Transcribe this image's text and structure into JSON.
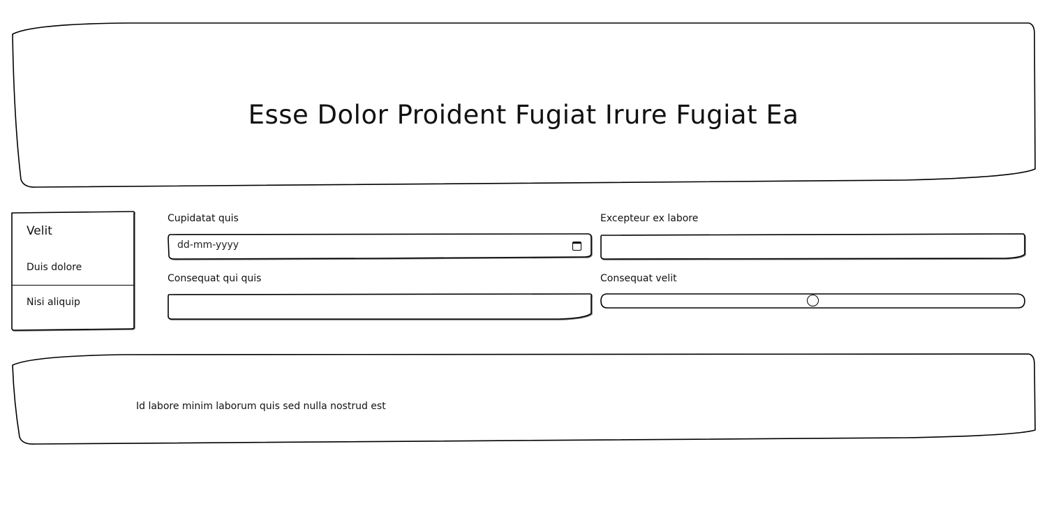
{
  "header": {
    "title": "Esse Dolor Proident Fugiat Irure Fugiat Ea"
  },
  "sidebar": {
    "title": "Velit",
    "items": [
      {
        "label": "Duis dolore"
      },
      {
        "label": "Nisi aliquip"
      }
    ]
  },
  "form": {
    "fields": [
      {
        "label": "Cupidatat quis",
        "type": "date",
        "placeholder": "dd-mm-yyyy"
      },
      {
        "label": "Excepteur ex labore",
        "type": "text",
        "value": ""
      },
      {
        "label": "Consequat qui quis",
        "type": "text",
        "value": ""
      },
      {
        "label": "Consequat velit",
        "type": "range",
        "value_fraction": 0.5
      }
    ]
  },
  "footer": {
    "text": "Id labore minim laborum quis sed nulla nostrud est"
  },
  "icons": {
    "date_picker": "calendar-icon"
  }
}
